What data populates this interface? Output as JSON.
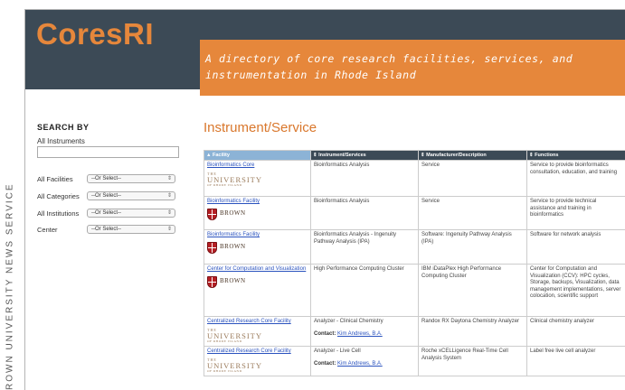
{
  "credit": "ROWN UNIVERSITY NEWS SERVICE",
  "header": {
    "logo": "CoresRI",
    "tagline": "A directory of core research facilities, services, and instrumentation in Rhode Island"
  },
  "sidebar": {
    "title": "SEARCH BY",
    "all_instruments_label": "All Instruments",
    "search_value": "",
    "filters": [
      {
        "label": "All Facilities",
        "value": "--Or Select--"
      },
      {
        "label": "All Categories",
        "value": "--Or Select--"
      },
      {
        "label": "All Institutions",
        "value": "--Or Select--"
      },
      {
        "label": "Center",
        "value": "--Or Select--"
      }
    ]
  },
  "main": {
    "title": "Instrument/Service",
    "columns": [
      "▲ Facility",
      "⇕ Instrument/Services",
      "⇕ Manufacturer/Description",
      "⇕ Functions"
    ],
    "logos": {
      "uri": {
        "the": "THE",
        "name": "UNIVERSITY",
        "sub": "OF RHODE ISLAND"
      },
      "brown": {
        "name": "BROWN"
      }
    },
    "contact_label": "Contact:",
    "rows": [
      {
        "facility": "Bioinformatics Core",
        "logo": "uri",
        "instrument": "Bioinformatics Analysis",
        "manufacturer": "Service",
        "functions": "Service to provide bioinformatics consultation, education, and training",
        "contact": ""
      },
      {
        "facility": "Bioinformatics Facility",
        "logo": "brown",
        "instrument": "Bioinformatics Analysis",
        "manufacturer": "Service",
        "functions": "Service to provide technical assistance and training in bioinformatics",
        "contact": ""
      },
      {
        "facility": "Bioinformatics Facility",
        "logo": "brown",
        "instrument": "Bioinformatics Analysis - Ingenuity Pathway Analysis (IPA)",
        "manufacturer": "Software: Ingenuity Pathway Analysis (IPA)",
        "functions": "Software for network analysis",
        "contact": ""
      },
      {
        "facility": "Center for Computation and Visualization",
        "logo": "brown",
        "instrument": "High Performance Computing Cluster",
        "manufacturer": "IBM iDataPlex High Performance Computing Cluster",
        "functions": "Center for Computation and Visualization (CCV): HPC cycles, Storage, backups, Visualization, data management implementations, server colocation, scientific support",
        "contact": ""
      },
      {
        "facility": "Centralized Research Core Facility",
        "logo": "uri",
        "instrument": "Analyzer - Clinical Chemistry",
        "manufacturer": "Randox RX Daytona Chemistry Analyzer",
        "functions": "Clinical chemistry analyzer",
        "contact": "Kim Andrews, B.A."
      },
      {
        "facility": "Centralized Research Core Facility",
        "logo": "uri",
        "instrument": "Analyzer - Live Cell",
        "manufacturer": "Roche xCELLigence Real-Time Cell Analysis System",
        "functions": "Label free live cell analyzer",
        "contact": "Kim Andrews, B.A."
      }
    ]
  }
}
